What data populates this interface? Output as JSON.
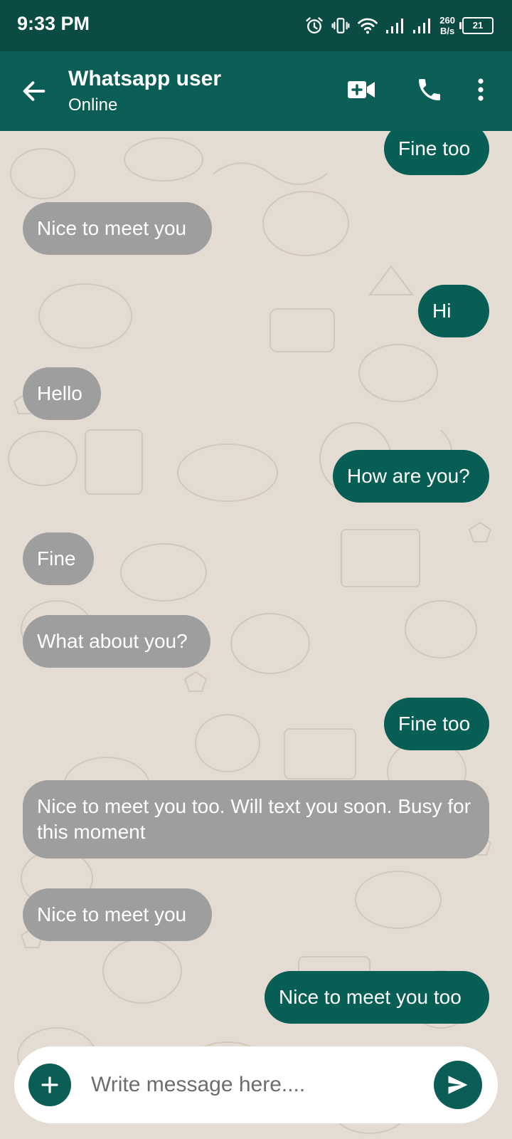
{
  "status_bar": {
    "time": "9:33 PM",
    "net_speed_value": "260",
    "net_speed_unit": "B/s",
    "battery": "21",
    "icons": [
      "alarm-icon",
      "vibrate-icon",
      "wifi-icon",
      "signal-icon",
      "signal-icon",
      "battery-icon"
    ]
  },
  "header": {
    "contact_name": "Whatsapp user",
    "contact_status": "Online",
    "icons": [
      "back-arrow-icon",
      "video-call-icon",
      "phone-icon",
      "more-vert-icon"
    ]
  },
  "messages": [
    {
      "text": "Fine too",
      "direction": "outgoing"
    },
    {
      "text": "Nice to meet you",
      "direction": "incoming"
    },
    {
      "text": "Hi",
      "direction": "outgoing"
    },
    {
      "text": "Hello",
      "direction": "incoming"
    },
    {
      "text": "How are you?",
      "direction": "outgoing"
    },
    {
      "text": "Fine",
      "direction": "incoming"
    },
    {
      "text": "What about you?",
      "direction": "incoming"
    },
    {
      "text": "Fine too",
      "direction": "outgoing"
    },
    {
      "text": "Nice to meet you too. Will text you soon. Busy for this moment",
      "direction": "incoming"
    },
    {
      "text": "Nice to meet you",
      "direction": "incoming"
    },
    {
      "text": "Nice to meet you too",
      "direction": "outgoing"
    }
  ],
  "input": {
    "placeholder": "Write message here....",
    "value": "",
    "icons": [
      "add-icon",
      "send-icon"
    ]
  },
  "colors": {
    "status_bar": "#0a4b43",
    "header": "#0b5e55",
    "outgoing_bubble": "#075e54",
    "incoming_bubble": "#9e9e9e",
    "chat_background": "#e4dbd3"
  }
}
